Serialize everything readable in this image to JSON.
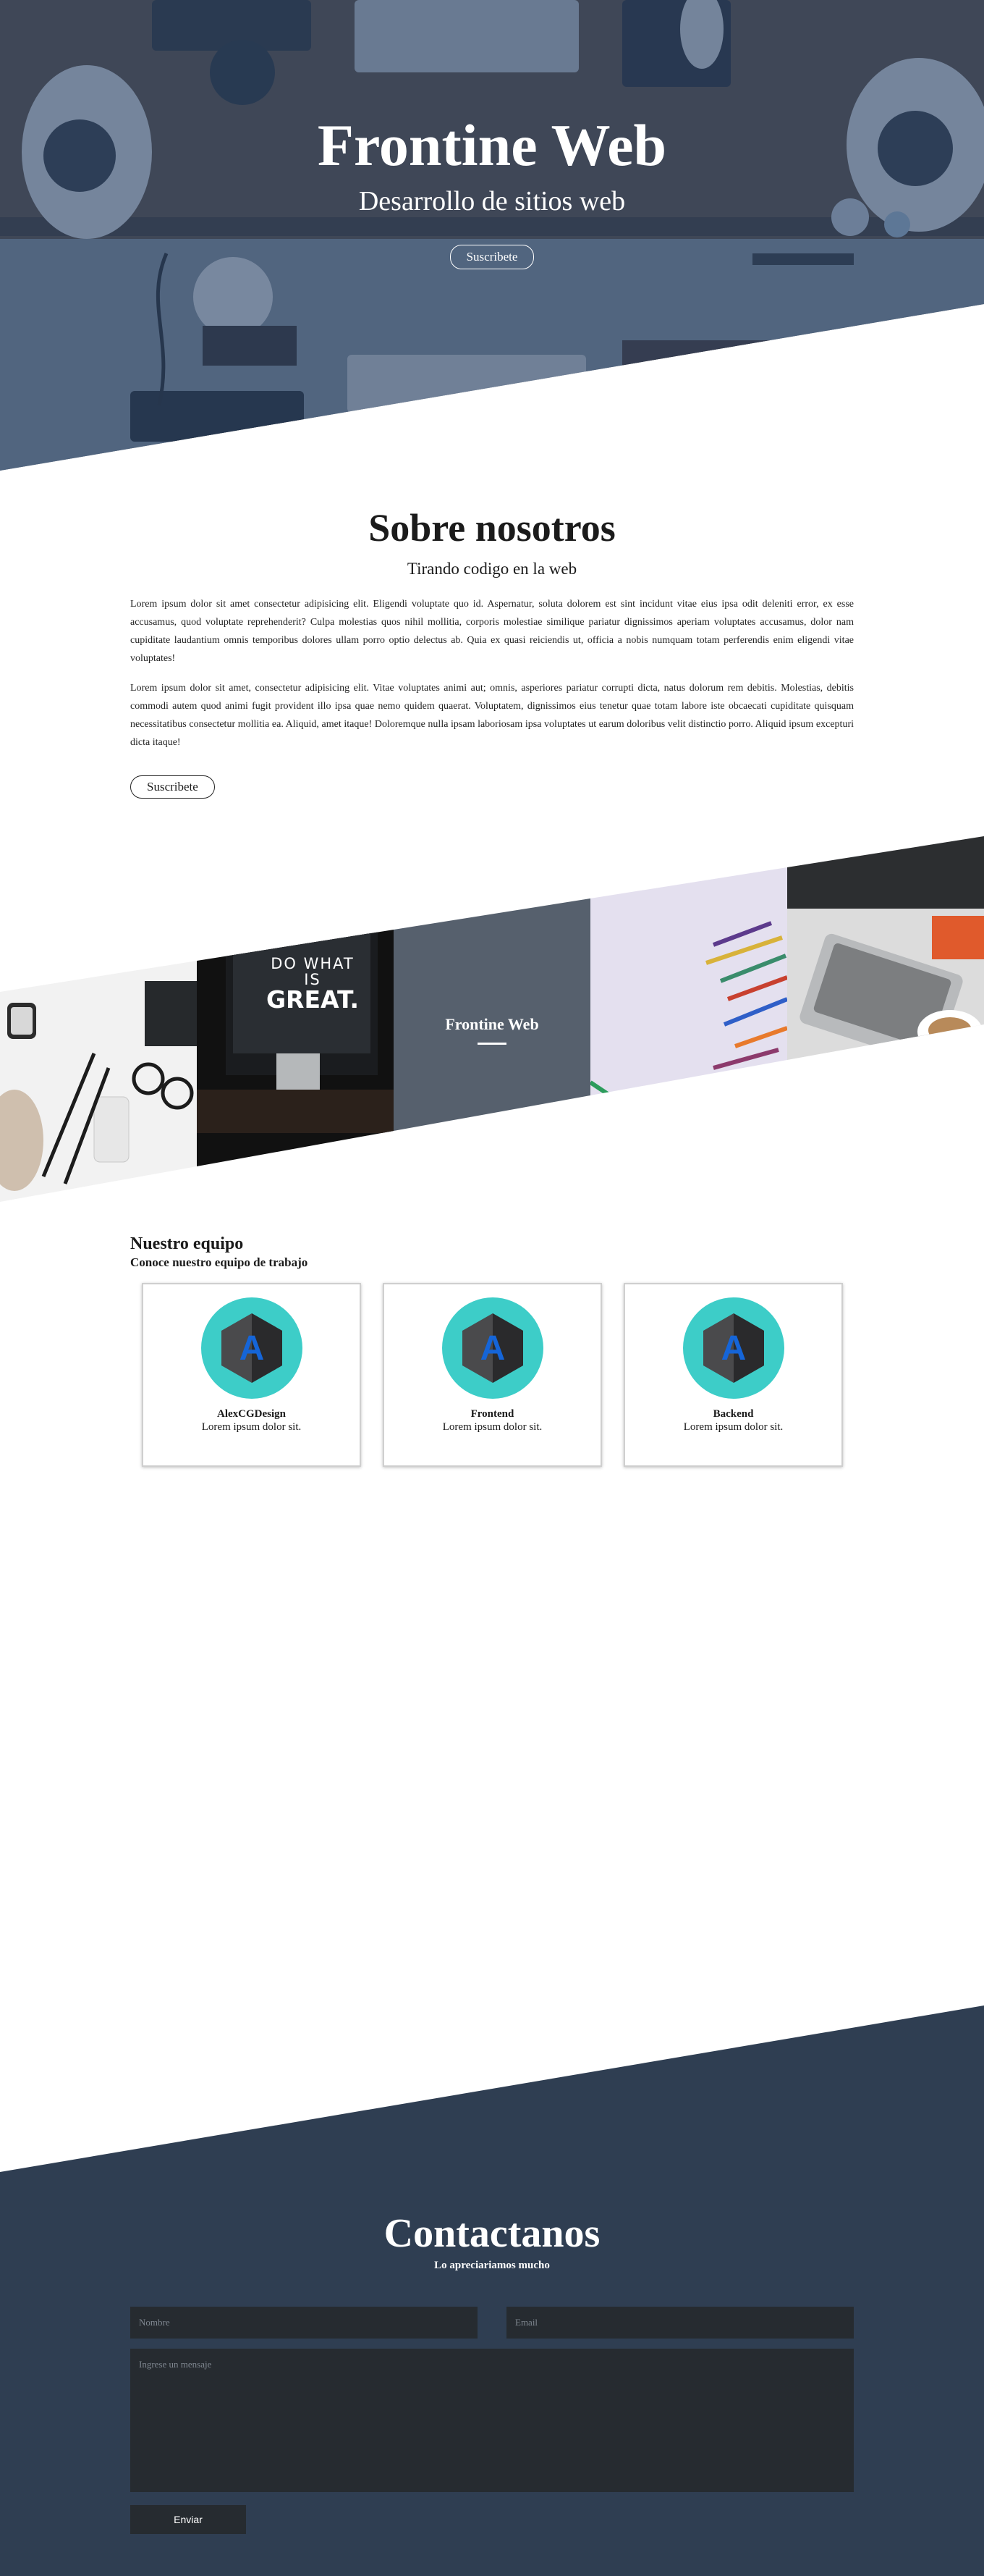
{
  "colors": {
    "hero_overlay": "#2e486e",
    "gallery_center": "#56606d",
    "avatar_circle": "#3dcdc8",
    "avatar_letter": "#1565d8",
    "contact_bg": "#2f3e52",
    "field_bg": "#262b30"
  },
  "hero": {
    "title": "Frontine Web",
    "subtitle": "Desarrollo de sitios web",
    "button": "Suscribete"
  },
  "about": {
    "title": "Sobre nosotros",
    "subtitle": "Tirando codigo en la web",
    "paragraphs": [
      "Lorem ipsum dolor sit amet consectetur adipisicing elit. Eligendi voluptate quo id. Aspernatur, soluta dolorem est sint incidunt vitae eius ipsa odit deleniti error, ex esse accusamus, quod voluptate reprehenderit? Culpa molestias quos nihil mollitia, corporis molestiae similique pariatur dignissimos aperiam voluptates accusamus, dolor nam cupiditate laudantium omnis temporibus dolores ullam porro optio delectus ab. Quia ex quasi reiciendis ut, officia a nobis numquam totam perferendis enim eligendi vitae voluptates!",
      "Lorem ipsum dolor sit amet, consectetur adipisicing elit. Vitae voluptates animi aut; omnis, asperiores pariatur corrupti dicta, natus dolorum rem debitis. Molestias, debitis commodi autem quod animi fugit provident illo ipsa quae nemo quidem quaerat. Voluptatem, dignissimos eius tenetur quae totam labore iste obcaecati cupiditate quisquam necessitatibus consectetur mollitia ea. Aliquid, amet itaque! Doloremque nulla ipsam laboriosam ipsa voluptates ut earum doloribus velit distinctio porro. Aliquid ipsum excepturi dicta itaque!"
    ],
    "button": "Suscribete"
  },
  "gallery": {
    "center_title": "Frontine Web",
    "sign_line1": "DO WHAT IS",
    "sign_line2": "GREAT."
  },
  "team": {
    "title": "Nuestro equipo",
    "subtitle": "Conoce nuestro equipo de trabajo",
    "avatar_letter": "A",
    "members": [
      {
        "name": "AlexCGDesign",
        "desc": "Lorem ipsum dolor sit."
      },
      {
        "name": "Frontend",
        "desc": "Lorem ipsum dolor sit."
      },
      {
        "name": "Backend",
        "desc": "Lorem ipsum dolor sit."
      }
    ]
  },
  "contact": {
    "title": "Contactanos",
    "subtitle": "Lo apreciariamos mucho",
    "name_placeholder": "Nombre",
    "email_placeholder": "Email",
    "message_placeholder": "Ingrese un mensaje",
    "send_button": "Enviar"
  }
}
